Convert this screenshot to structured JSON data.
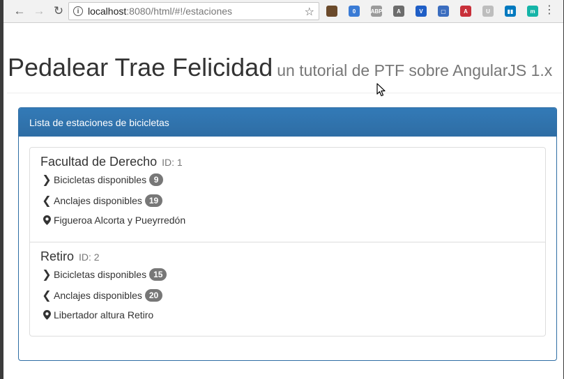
{
  "browser": {
    "url_host": "localhost",
    "url_rest": ":8080/html/#!/estaciones",
    "extensions": [
      {
        "name": "ext-1",
        "color": "#6b4a2b",
        "text": ""
      },
      {
        "name": "ext-2",
        "color": "#3a7bd5",
        "text": "0"
      },
      {
        "name": "adblock-plus",
        "color": "#9a9a9a",
        "text": "ABP"
      },
      {
        "name": "ext-4",
        "color": "#6c6c6c",
        "text": "A"
      },
      {
        "name": "ext-5",
        "color": "#1f5ec6",
        "text": "V"
      },
      {
        "name": "ext-6",
        "color": "#3b6dbf",
        "text": "▢"
      },
      {
        "name": "angular",
        "color": "#c8303a",
        "text": "A"
      },
      {
        "name": "ext-8",
        "color": "#bdbdbd",
        "text": "U"
      },
      {
        "name": "trello",
        "color": "#0079bf",
        "text": "▮▮"
      },
      {
        "name": "ext-10",
        "color": "#15b4a7",
        "text": "m"
      }
    ]
  },
  "header": {
    "title": "Pedalear Trae Felicidad",
    "subtitle": "un tutorial de PTF sobre AngularJS 1.x"
  },
  "panel": {
    "heading": "Lista de estaciones de bicicletas"
  },
  "stations": [
    {
      "name": "Facultad de Derecho",
      "id_label": "ID: 1",
      "bikes_label": "Bicicletas disponibles",
      "bikes": "9",
      "docks_label": "Anclajes disponibles",
      "docks": "19",
      "address": "Figueroa Alcorta y Pueyrredón"
    },
    {
      "name": "Retiro",
      "id_label": "ID: 2",
      "bikes_label": "Bicicletas disponibles",
      "bikes": "15",
      "docks_label": "Anclajes disponibles",
      "docks": "20",
      "address": "Libertador altura Retiro"
    }
  ]
}
